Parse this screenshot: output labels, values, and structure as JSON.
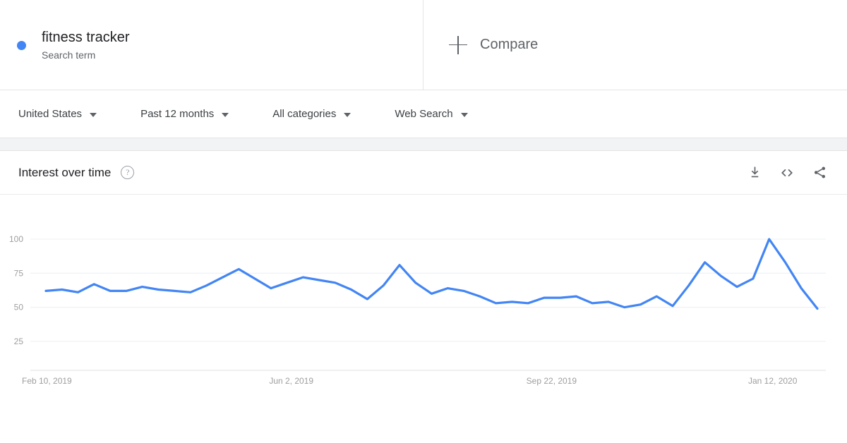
{
  "search_panel": {
    "term": "fitness tracker",
    "type_label": "Search term",
    "dot_color": "#4285f4"
  },
  "compare_panel": {
    "label": "Compare",
    "icon": "plus-icon"
  },
  "filters": [
    {
      "label": "United States",
      "icon": "chevron-down-icon"
    },
    {
      "label": "Past 12 months",
      "icon": "chevron-down-icon"
    },
    {
      "label": "All categories",
      "icon": "chevron-down-icon"
    },
    {
      "label": "Web Search",
      "icon": "chevron-down-icon"
    }
  ],
  "card": {
    "title": "Interest over time",
    "help_icon": "?",
    "tools": [
      {
        "name": "download-icon",
        "label": "Download"
      },
      {
        "name": "embed-icon",
        "label": "Embed"
      },
      {
        "name": "share-icon",
        "label": "Share"
      }
    ]
  },
  "chart_data": {
    "type": "line",
    "title": "Interest over time",
    "xlabel": "",
    "ylabel": "",
    "ylim": [
      0,
      100
    ],
    "yticks": [
      100,
      75,
      50,
      25
    ],
    "grid": true,
    "legend": false,
    "line_color": "#4285f4",
    "x_tick_labels": [
      "Feb 10, 2019",
      "Jun 2, 2019",
      "Sep 22, 2019",
      "Jan 12, 2020"
    ],
    "x_tick_indices": [
      0,
      16,
      32,
      48
    ],
    "series": [
      {
        "name": "fitness tracker",
        "values": [
          62,
          63,
          61,
          67,
          62,
          62,
          65,
          63,
          62,
          61,
          66,
          72,
          78,
          71,
          64,
          68,
          72,
          70,
          68,
          63,
          56,
          66,
          81,
          68,
          60,
          64,
          62,
          58,
          53,
          54,
          53,
          57,
          57,
          58,
          53,
          54,
          50,
          52,
          58,
          51,
          66,
          83,
          73,
          65,
          71,
          100,
          83,
          64,
          49
        ]
      }
    ]
  }
}
